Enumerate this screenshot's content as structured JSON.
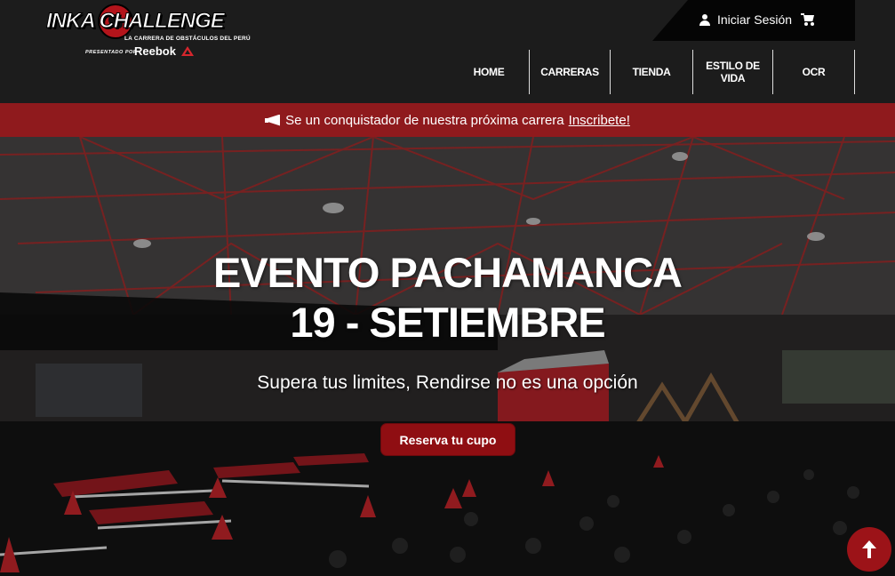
{
  "brand": {
    "logo_text": "INKA CHALLENGE",
    "tagline": "LA CARRERA DE OBSTÁCULOS DEL PERÚ",
    "presented_by": "PRESENTADO POR",
    "sponsor": "Reebok"
  },
  "account": {
    "login_label": "Iniciar Sesión"
  },
  "nav": {
    "items": [
      {
        "label": "HOME"
      },
      {
        "label": "CARRERAS"
      },
      {
        "label": "TIENDA"
      },
      {
        "label": "ESTILO DE VIDA"
      },
      {
        "label": "OCR"
      }
    ]
  },
  "promo": {
    "text": "Se un conquistador de nuestra próxima carrera",
    "link_label": "Inscribete!",
    "icon": "megaphone-icon"
  },
  "hero": {
    "title_line1": "EVENTO PACHAMANCA",
    "title_line2": "19 - SETIEMBRE",
    "subtitle": "Supera tus limites, Rendirse no es una opción",
    "cta_label": "Reserva tu cupo"
  },
  "colors": {
    "header_bg": "#1c1c1c",
    "promo_bg": "#8f1a1d",
    "cta_bg": "#8f0e12",
    "scroll_top_bg": "#9c1318"
  }
}
